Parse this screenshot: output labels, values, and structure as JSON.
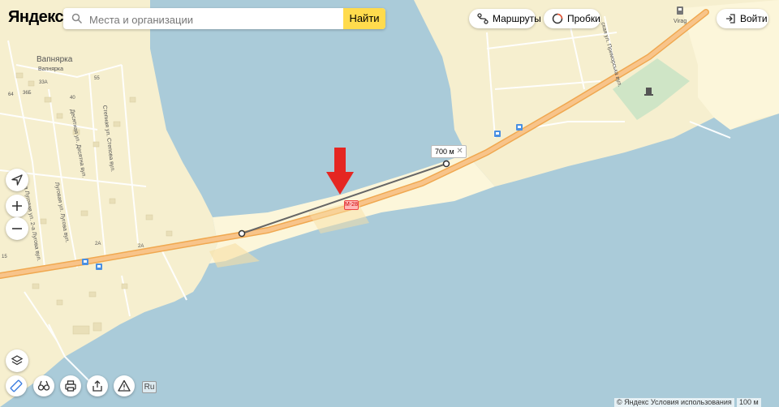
{
  "header": {
    "logo": "Яндекс",
    "search_placeholder": "Места и организации",
    "search_value": "",
    "search_button": "Найти",
    "routes_label": "Маршруты",
    "traffic_label": "Пробки",
    "login_label": "Войти"
  },
  "map": {
    "labels": {
      "village": "Вапнярка",
      "village_small": "Вапнярка",
      "street_stepnaya": "Степная ул. Степова вул.",
      "street_desyatnaya": "Десятная ул. Десятна вул.",
      "street_lugovaya": "Луговая ул. Лугова вул.",
      "street_lugovaya2": "а Луговая ул. 2-а Лугова вул.",
      "street_primorskaya": "ская ул. Приморська вул.",
      "virage": "Virag"
    },
    "house_numbers": [
      "33А",
      "55",
      "64",
      "36Б",
      "40",
      "2А",
      "2А",
      "15"
    ],
    "route_badge": "М-28",
    "distance": "700 м",
    "distance_close": "✕"
  },
  "controls": {
    "language": "Ru"
  },
  "footer": {
    "copyright": "© Яндекс Условия использования",
    "scale": "100 м"
  },
  "icons": [
    "search-icon",
    "routes-icon",
    "traffic-icon",
    "login-icon",
    "locate-icon",
    "zoom-in-icon",
    "zoom-out-icon",
    "layers-icon",
    "ruler-icon",
    "binoculars-icon",
    "print-icon",
    "share-icon",
    "warning-icon",
    "down-arrow-icon",
    "bus-stop-icon",
    "monument-icon",
    "fuel-icon"
  ],
  "colors": {
    "water": "#aacbd9",
    "land": "#f6efcf",
    "beach": "#fcf6da",
    "road_main": "#f6b96a",
    "search_button": "#ffdb4d",
    "logo_accent": "#ff3333",
    "arrow": "#e52622"
  }
}
